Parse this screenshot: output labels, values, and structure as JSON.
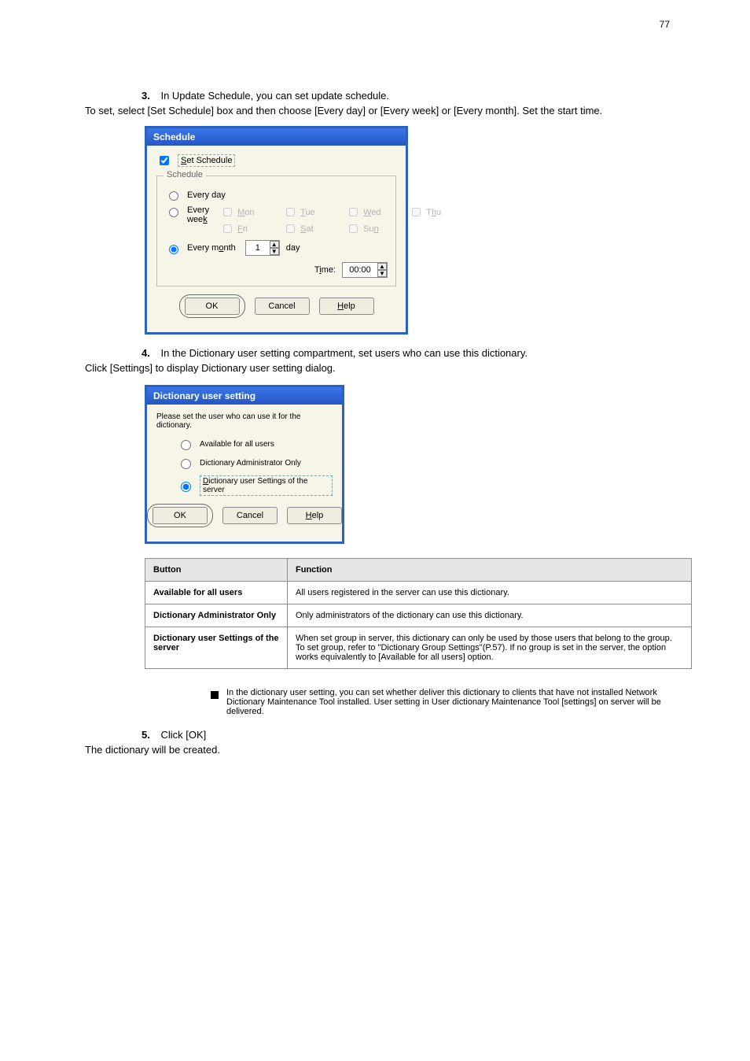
{
  "page_number_top": "77",
  "step3": {
    "num": "3.",
    "text": "In Update Schedule, you can set update schedule.",
    "note": "To set, select [Set Schedule] box and then choose [Every day] or [Every week] or [Every month]. Set the start time."
  },
  "schedule_dialog": {
    "title": "Schedule",
    "set_schedule_label": "Set Schedule",
    "group_label": "Schedule",
    "opt_every_day": "Every day",
    "opt_every_week": "Every week",
    "opt_every_month": "Every month",
    "days": [
      "Mon",
      "Tue",
      "Wed",
      "Thu",
      "Fri",
      "Sat",
      "Sun"
    ],
    "month_day_value": "1",
    "month_day_label": "day",
    "time_label": "Time:",
    "time_value": "00:00",
    "ok": "OK",
    "cancel": "Cancel",
    "help": "Help"
  },
  "step4": {
    "num": "4.",
    "text": "In the Dictionary user setting compartment, set users who can use this dictionary.",
    "sub": "Click [Settings] to display Dictionary user setting dialog."
  },
  "dict_dialog": {
    "title": "Dictionary user setting",
    "instruction": "Please set the user who can use it for the dictionary.",
    "opt_all": "Available for all users",
    "opt_admin": "Dictionary Administrator Only",
    "opt_server": "Dictionary user Settings of the server",
    "ok": "OK",
    "cancel": "Cancel",
    "help": "Help"
  },
  "table": {
    "headers": [
      "Button",
      "Function"
    ],
    "rows": [
      {
        "button": "Available for all users",
        "function": "All users registered in the server can use this dictionary."
      },
      {
        "button": "Dictionary Administrator Only",
        "function": "Only administrators of the dictionary can use this dictionary."
      },
      {
        "button": "Dictionary user Settings of the server",
        "function": "When set group in server, this dictionary can only be used by those users that belong to the group. To set group, refer to \"Dictionary Group Settings\"(P.57). If no group is set in the server, the option works equivalently to [Available for all users] option."
      }
    ]
  },
  "appendix": {
    "text": "In the dictionary user setting, you can set whether deliver this dictionary to clients that have not installed Network Dictionary Maintenance Tool installed. User setting in User dictionary Maintenance Tool [settings] on server will be delivered."
  },
  "step5": {
    "num": "5.",
    "text": "Click [OK]",
    "sub": "The dictionary will be created."
  }
}
